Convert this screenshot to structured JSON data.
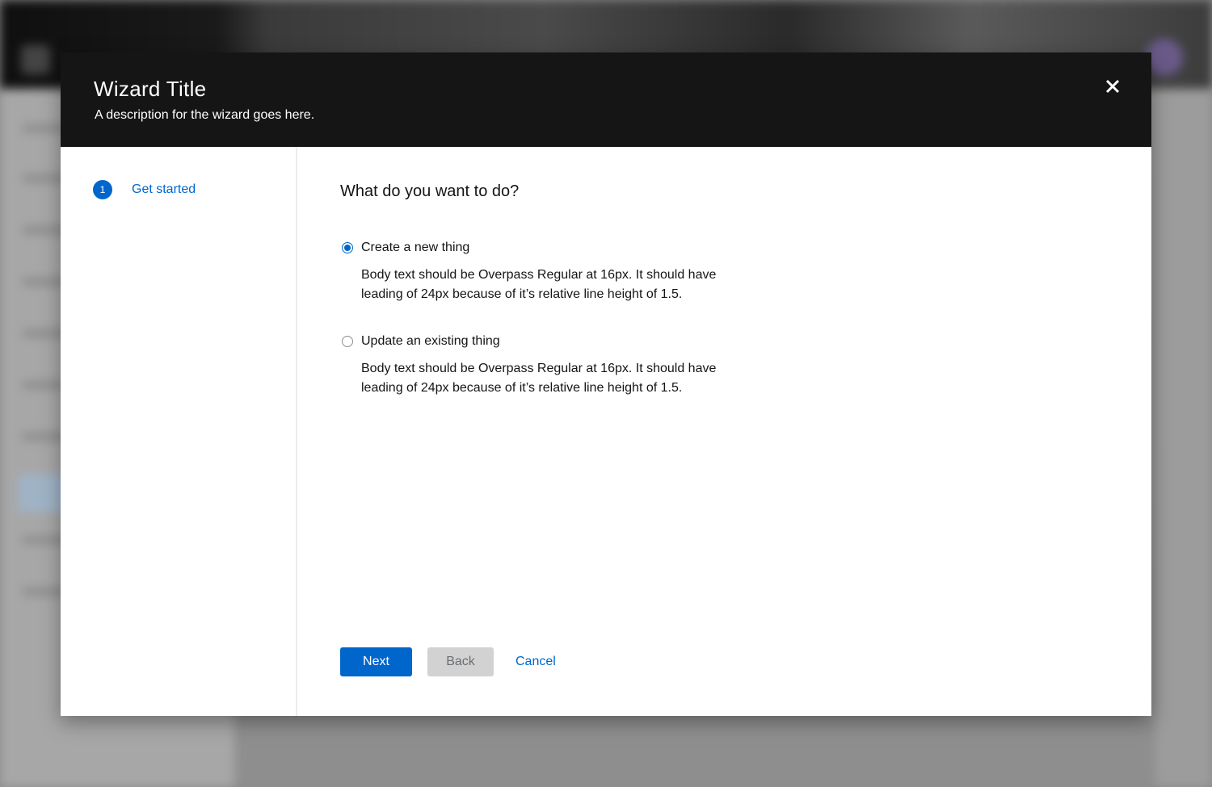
{
  "wizard": {
    "title": "Wizard Title",
    "description": "A description for the wizard goes here.",
    "close_icon": "close-icon"
  },
  "nav": {
    "steps": [
      {
        "number": "1",
        "label": "Get started",
        "current": true
      }
    ]
  },
  "main": {
    "question": "What do you want to do?",
    "options": [
      {
        "label": "Create a new thing",
        "description": "Body text should be Overpass Regular at 16px. It should have leading of 24px because of it’s relative line height of 1.5.",
        "checked": true
      },
      {
        "label": "Update an existing thing",
        "description": "Body text should be Overpass Regular at 16px. It should have leading of 24px because of it’s relative line height of 1.5.",
        "checked": false
      }
    ]
  },
  "footer": {
    "next_label": "Next",
    "back_label": "Back",
    "cancel_label": "Cancel"
  },
  "colors": {
    "accent": "#0066cc",
    "header_bg": "#151515",
    "disabled_bg": "#d2d2d2"
  }
}
